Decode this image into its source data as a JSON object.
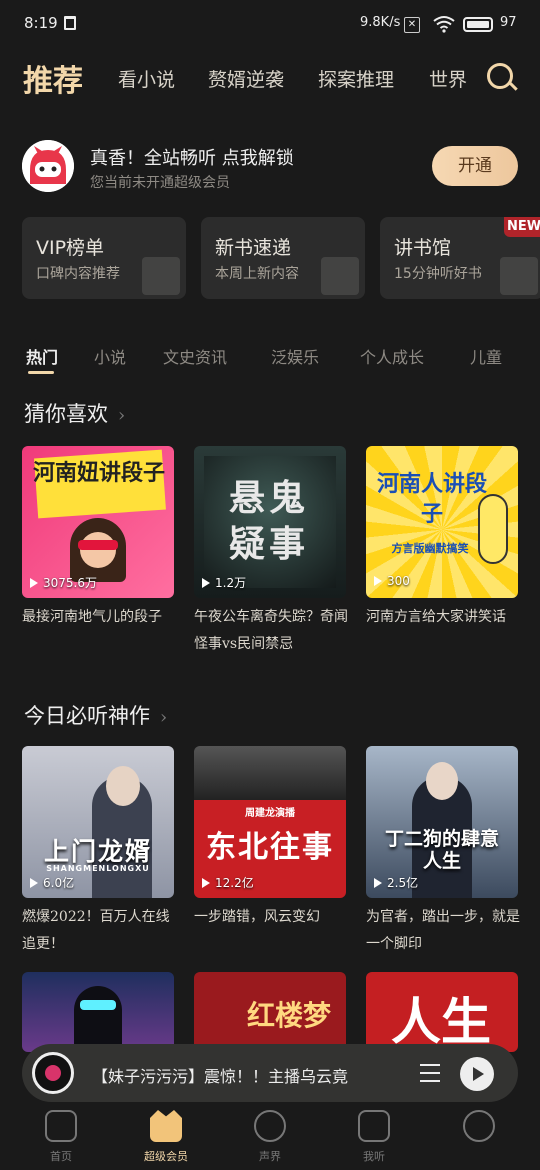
{
  "status_bar": {
    "time": "8:19",
    "speed": "9.8K/s",
    "battery": "97"
  },
  "top_nav": {
    "active": "推荐",
    "tabs": [
      "看小说",
      "赘婿逆袭",
      "探案推理",
      "世界"
    ]
  },
  "vip_banner": {
    "title": "真香！全站畅听 点我解锁",
    "subtitle": "您当前未开通超级会员",
    "button": "开通"
  },
  "category_cards": [
    {
      "title": "VIP榜单",
      "subtitle": "口碑内容推荐"
    },
    {
      "title": "新书速递",
      "subtitle": "本周上新内容"
    },
    {
      "title": "讲书馆",
      "subtitle": "15分钟听好书"
    }
  ],
  "new_tag": "NEW",
  "sub_tabs": [
    "热门",
    "小说",
    "文史资讯",
    "泛娱乐",
    "个人成长",
    "儿童"
  ],
  "section1": {
    "title": "猜你喜欢",
    "items": [
      {
        "cover_text": "河南妞讲段子",
        "plays": "3075.6万",
        "title": "最接河南地气儿的段子"
      },
      {
        "cover_text": "悬鬼疑事",
        "plays": "1.2万",
        "title": "午夜公车离奇失踪？奇闻怪事vs民间禁忌"
      },
      {
        "cover_text": "河南人讲段子",
        "cover_sub": "方言版幽默搞笑",
        "plays": "300",
        "title": "河南方言给大家讲笑话"
      }
    ]
  },
  "section2": {
    "title": "今日必听神作",
    "items": [
      {
        "cover_text": "上门龙婿",
        "cover_sub": "SHANGMENLONGXU",
        "plays": "6.0亿",
        "title": "燃爆2022！百万人在线追更！"
      },
      {
        "cover_text": "东北往事",
        "cover_sub": "周建龙演播",
        "plays": "12.2亿",
        "title": "一步踏错，风云变幻"
      },
      {
        "cover_text": "丁二狗的肆意人生",
        "plays": "2.5亿",
        "title": "为官者，踏出一步，就是一个脚印"
      }
    ]
  },
  "section3": {
    "items": [
      {
        "cover_text": ""
      },
      {
        "cover_text": "红楼梦"
      },
      {
        "cover_text": "人生"
      }
    ]
  },
  "player": {
    "title": "【妹子污污污】震惊！！主播乌云竟"
  },
  "bottom_nav": [
    {
      "label": "首页",
      "active": false
    },
    {
      "label": "超级会员",
      "active": true
    },
    {
      "label": "声界",
      "active": false
    },
    {
      "label": "我听",
      "active": false
    },
    {
      "label": "",
      "active": false
    }
  ],
  "colors": {
    "accent": "#f2d7aa",
    "background": "#1a1a1a",
    "card": "#2c2c2c"
  }
}
